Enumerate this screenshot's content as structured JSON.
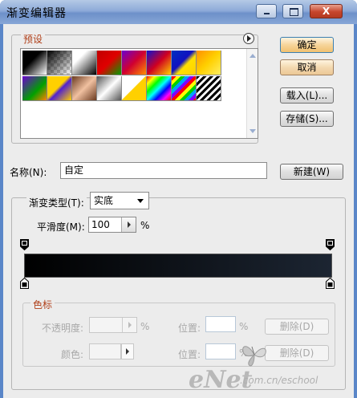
{
  "window": {
    "title": "渐变编辑器",
    "close_glyph": "X"
  },
  "presets": {
    "label": "预设",
    "menu_icon": "circle-arrow-right-icon"
  },
  "buttons": {
    "ok": "确定",
    "cancel": "取消",
    "load": "载入(L)...",
    "save": "存储(S)...",
    "new": "新建(W)"
  },
  "name": {
    "label": "名称(N):",
    "value": "自定"
  },
  "gradient": {
    "type_label": "渐变类型(T):",
    "type_value": "实底",
    "smoothness_label": "平滑度(M):",
    "smoothness_value": "100",
    "smoothness_unit": "%",
    "bar_colors": [
      "#000000",
      "#1c2532"
    ]
  },
  "stops": {
    "label": "色标",
    "opacity_label": "不透明度:",
    "opacity_unit": "%",
    "location_label_1": "位置:",
    "location_unit_1": "%",
    "delete_1": "删除(D)",
    "color_label": "颜色:",
    "location_label_2": "位置:",
    "location_unit_2": "%",
    "delete_2": "删除(D)"
  },
  "watermark": {
    "logo": "eNet",
    "url": ".com.cn/eschool"
  }
}
